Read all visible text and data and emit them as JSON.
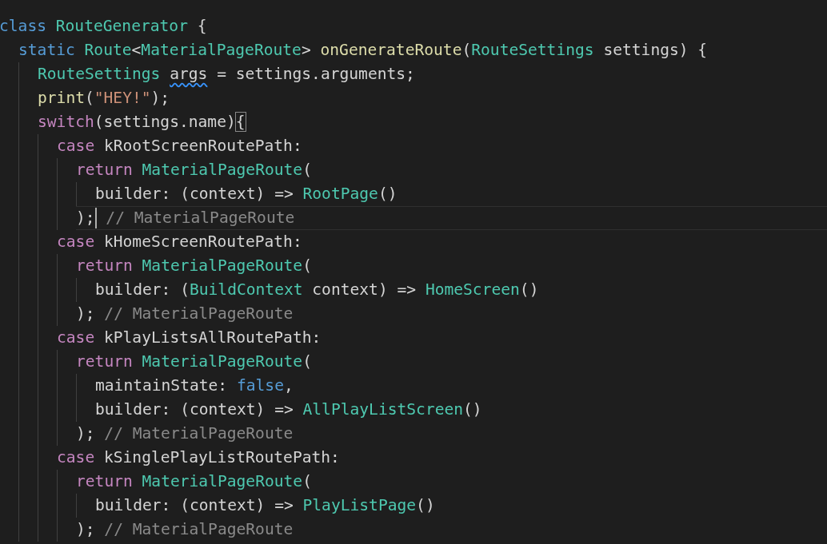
{
  "editor": {
    "lines": [
      {
        "tokens": [
          {
            "kind": "keyword",
            "text": "class "
          },
          {
            "kind": "type",
            "text": "RouteGenerator"
          },
          {
            "kind": "plain",
            "text": " {"
          }
        ],
        "children": [
          {
            "tokens": [
              {
                "kind": "keyword",
                "text": "static "
              },
              {
                "kind": "type",
                "text": "Route"
              },
              {
                "kind": "plain",
                "text": "<"
              },
              {
                "kind": "type",
                "text": "MaterialPageRoute"
              },
              {
                "kind": "plain",
                "text": "> "
              },
              {
                "kind": "function",
                "text": "onGenerateRoute"
              },
              {
                "kind": "plain",
                "text": "("
              },
              {
                "kind": "type",
                "text": "RouteSettings"
              },
              {
                "kind": "plain",
                "text": " settings) {"
              }
            ],
            "children": [
              {
                "tokens": [
                  {
                    "kind": "type",
                    "text": "RouteSettings "
                  },
                  {
                    "kind": "plain",
                    "text": "args",
                    "warning": true
                  },
                  {
                    "kind": "plain",
                    "text": " = settings.arguments;"
                  }
                ]
              },
              {
                "tokens": [
                  {
                    "kind": "function",
                    "text": "print"
                  },
                  {
                    "kind": "plain",
                    "text": "("
                  },
                  {
                    "kind": "string",
                    "text": "\"HEY!\""
                  },
                  {
                    "kind": "plain",
                    "text": ");"
                  }
                ]
              },
              {
                "tokens": [
                  {
                    "kind": "control",
                    "text": "switch"
                  },
                  {
                    "kind": "plain",
                    "text": "(settings.name)"
                  },
                  {
                    "kind": "plain",
                    "text": "{",
                    "matched": true
                  }
                ],
                "children": [
                  {
                    "tokens": [
                      {
                        "kind": "control",
                        "text": "case"
                      },
                      {
                        "kind": "plain",
                        "text": " kRootScreenRoutePath:"
                      }
                    ],
                    "children": [
                      {
                        "tokens": [
                          {
                            "kind": "control",
                            "text": "return "
                          },
                          {
                            "kind": "type",
                            "text": "MaterialPageRoute"
                          },
                          {
                            "kind": "plain",
                            "text": "("
                          }
                        ],
                        "children": [
                          {
                            "tokens": [
                              {
                                "kind": "plain",
                                "text": "builder: (context) => "
                              },
                              {
                                "kind": "type",
                                "text": "RootPage"
                              },
                              {
                                "kind": "plain",
                                "text": "()"
                              }
                            ]
                          }
                        ]
                      },
                      {
                        "tokens": [
                          {
                            "kind": "plain",
                            "text": ");"
                          },
                          {
                            "kind": "comment",
                            "text": "// MaterialPageRoute"
                          }
                        ],
                        "cursor": true
                      }
                    ]
                  },
                  {
                    "tokens": [
                      {
                        "kind": "control",
                        "text": "case"
                      },
                      {
                        "kind": "plain",
                        "text": " kHomeScreenRoutePath:"
                      }
                    ],
                    "children": [
                      {
                        "tokens": [
                          {
                            "kind": "control",
                            "text": "return "
                          },
                          {
                            "kind": "type",
                            "text": "MaterialPageRoute"
                          },
                          {
                            "kind": "plain",
                            "text": "("
                          }
                        ],
                        "children": [
                          {
                            "tokens": [
                              {
                                "kind": "plain",
                                "text": "builder: ("
                              },
                              {
                                "kind": "type",
                                "text": "BuildContext"
                              },
                              {
                                "kind": "plain",
                                "text": " context) => "
                              },
                              {
                                "kind": "type",
                                "text": "HomeScreen"
                              },
                              {
                                "kind": "plain",
                                "text": "()"
                              }
                            ]
                          }
                        ]
                      },
                      {
                        "tokens": [
                          {
                            "kind": "plain",
                            "text": ");"
                          },
                          {
                            "kind": "comment",
                            "text": "// MaterialPageRoute"
                          }
                        ]
                      }
                    ]
                  },
                  {
                    "tokens": [
                      {
                        "kind": "control",
                        "text": "case"
                      },
                      {
                        "kind": "plain",
                        "text": " kPlayListsAllRoutePath:"
                      }
                    ],
                    "children": [
                      {
                        "tokens": [
                          {
                            "kind": "control",
                            "text": "return "
                          },
                          {
                            "kind": "type",
                            "text": "MaterialPageRoute"
                          },
                          {
                            "kind": "plain",
                            "text": "("
                          }
                        ],
                        "children": [
                          {
                            "tokens": [
                              {
                                "kind": "plain",
                                "text": "maintainState: "
                              },
                              {
                                "kind": "keyword",
                                "text": "false"
                              },
                              {
                                "kind": "plain",
                                "text": ","
                              }
                            ]
                          },
                          {
                            "tokens": [
                              {
                                "kind": "plain",
                                "text": "builder: (context) => "
                              },
                              {
                                "kind": "type",
                                "text": "AllPlayListScreen"
                              },
                              {
                                "kind": "plain",
                                "text": "()"
                              }
                            ]
                          }
                        ]
                      },
                      {
                        "tokens": [
                          {
                            "kind": "plain",
                            "text": ");"
                          },
                          {
                            "kind": "comment",
                            "text": "// MaterialPageRoute"
                          }
                        ]
                      }
                    ]
                  },
                  {
                    "tokens": [
                      {
                        "kind": "control",
                        "text": "case"
                      },
                      {
                        "kind": "plain",
                        "text": " kSinglePlayListRoutePath:"
                      }
                    ],
                    "children": [
                      {
                        "tokens": [
                          {
                            "kind": "control",
                            "text": "return "
                          },
                          {
                            "kind": "type",
                            "text": "MaterialPageRoute"
                          },
                          {
                            "kind": "plain",
                            "text": "("
                          }
                        ],
                        "children": [
                          {
                            "tokens": [
                              {
                                "kind": "plain",
                                "text": "builder: (context) => "
                              },
                              {
                                "kind": "type",
                                "text": "PlayListPage"
                              },
                              {
                                "kind": "plain",
                                "text": "()"
                              }
                            ]
                          }
                        ]
                      },
                      {
                        "tokens": [
                          {
                            "kind": "plain",
                            "text": ");"
                          },
                          {
                            "kind": "comment",
                            "text": "// MaterialPageRoute"
                          }
                        ]
                      }
                    ]
                  }
                ]
              }
            ]
          }
        ]
      }
    ]
  }
}
